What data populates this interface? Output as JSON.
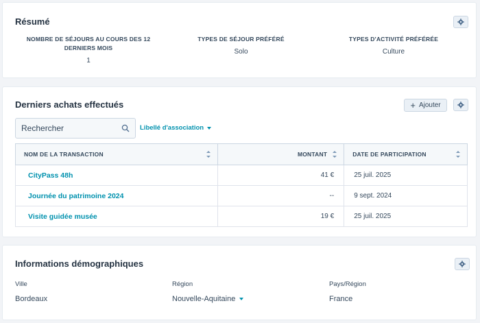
{
  "summary": {
    "title": "Résumé",
    "columns": [
      {
        "label_line1": "NOMBRE DE SÉJOURS AU COURS DES 12",
        "label_line2": "DERNIERS MOIS",
        "value": "1"
      },
      {
        "label_line1": "TYPES DE SÉJOUR PRÉFÉRÉ",
        "label_line2": "",
        "value": "Solo"
      },
      {
        "label_line1": "TYPES D'ACTIVITÉ PRÉFÉRÉE",
        "label_line2": "",
        "value": "Culture"
      }
    ]
  },
  "purchases": {
    "title": "Derniers achats effectués",
    "add_label": "Ajouter",
    "search": {
      "placeholder": "Rechercher",
      "value": ""
    },
    "association_filter": "Libellé d'association",
    "columns": {
      "name": "NOM DE LA TRANSACTION",
      "amount": "MONTANT",
      "date": "DATE DE PARTICIPATION"
    },
    "rows": [
      {
        "name": "CityPass 48h",
        "amount": "41 €",
        "date": "25 juil. 2025"
      },
      {
        "name": "Journée du patrimoine 2024",
        "amount": "--",
        "date": "9 sept. 2024"
      },
      {
        "name": "Visite guidée musée",
        "amount": "19 €",
        "date": "25 juil. 2025"
      }
    ]
  },
  "demographics": {
    "title": "Informations démographiques",
    "fields": [
      {
        "label": "Ville",
        "value": "Bordeaux"
      },
      {
        "label": "Région",
        "value": "Nouvelle-Aquitaine"
      },
      {
        "label": "Pays/Région",
        "value": "France"
      }
    ]
  },
  "colors": {
    "page_bg": "#f2f4f7",
    "card_bg": "#ffffff",
    "link": "#0091ae",
    "text": "#33475b",
    "header_bg": "#f5f8fa",
    "button_bg": "#eaf0f6"
  }
}
